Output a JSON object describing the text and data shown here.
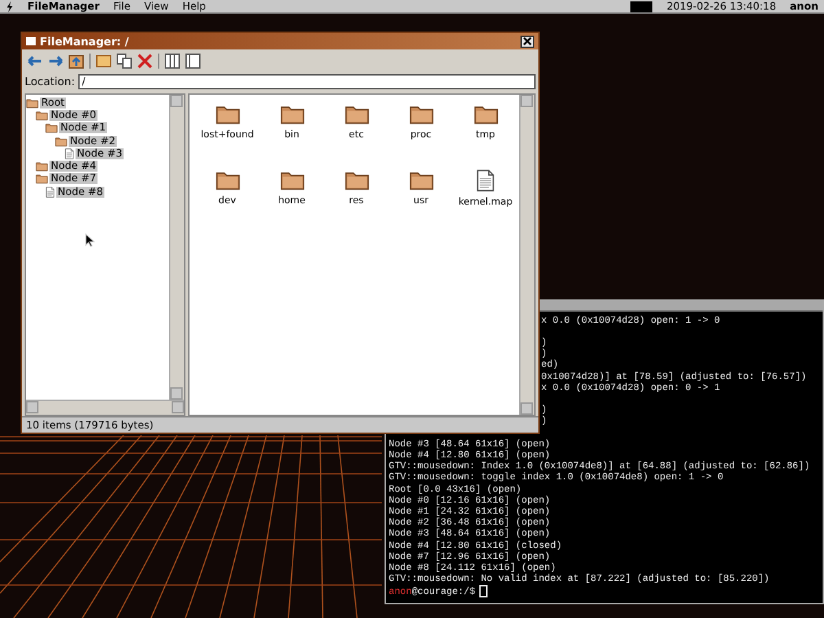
{
  "menu_bar": {
    "app_name": "FileManager",
    "menus": [
      "File",
      "View",
      "Help"
    ],
    "clock": "2019-02-26 13:40:18",
    "user": "anon"
  },
  "file_manager": {
    "title": "FileManager: /",
    "location_label": "Location:",
    "location": "/",
    "tree": [
      {
        "label": "Root",
        "kind": "folder",
        "children": [
          {
            "label": "Node #0",
            "kind": "folder",
            "children": [
              {
                "label": "Node #1",
                "kind": "folder",
                "children": [
                  {
                    "label": "Node #2",
                    "kind": "folder",
                    "children": [
                      {
                        "label": "Node #3",
                        "kind": "file"
                      }
                    ]
                  }
                ]
              }
            ]
          },
          {
            "label": "Node #4",
            "kind": "folder"
          },
          {
            "label": "Node #7",
            "kind": "folder",
            "children": [
              {
                "label": "Node #8",
                "kind": "file"
              }
            ]
          }
        ]
      }
    ],
    "items": [
      {
        "name": "lost+found",
        "kind": "folder"
      },
      {
        "name": "bin",
        "kind": "folder"
      },
      {
        "name": "etc",
        "kind": "folder"
      },
      {
        "name": "proc",
        "kind": "folder"
      },
      {
        "name": "tmp",
        "kind": "folder"
      },
      {
        "name": "dev",
        "kind": "folder"
      },
      {
        "name": "home",
        "kind": "folder"
      },
      {
        "name": "res",
        "kind": "folder"
      },
      {
        "name": "usr",
        "kind": "folder"
      },
      {
        "name": "kernel.map",
        "kind": "file"
      }
    ],
    "status": "10 items (179716 bytes)"
  },
  "terminal": {
    "partial_blocks": [
      [
        "x 0.0 (0x10074d28) open: 1 -> 0"
      ],
      [
        ")",
        ")",
        "ed)",
        "0x10074d28)] at [78.59] (adjusted to: [76.57])",
        "x 0.0 (0x10074d28) open: 0 -> 1"
      ],
      [
        ")",
        ")"
      ]
    ],
    "lines": [
      "Node #3 [48.64 61x16] (open)",
      "Node #4 [12.80 61x16] (open)",
      "GTV::mousedown: Index 1.0 (0x10074de8)] at [64.88] (adjusted to: [62.86])",
      "GTV::mousedown: toggle index 1.0 (0x10074de8) open: 1 -> 0",
      "Root [0.0 43x16] (open)",
      "Node #0 [12.16 61x16] (open)",
      "Node #1 [24.32 61x16] (open)",
      "Node #2 [36.48 61x16] (open)",
      "Node #3 [48.64 61x16] (open)",
      "Node #4 [12.80 61x16] (closed)",
      "Node #7 [12.96 61x16] (open)",
      "Node #8 [24.112 61x16] (open)",
      "GTV::mousedown: No valid index at [87.222] (adjusted to: [85.220])"
    ],
    "prompt": {
      "user": "anon",
      "path": "@courage:/$"
    }
  }
}
